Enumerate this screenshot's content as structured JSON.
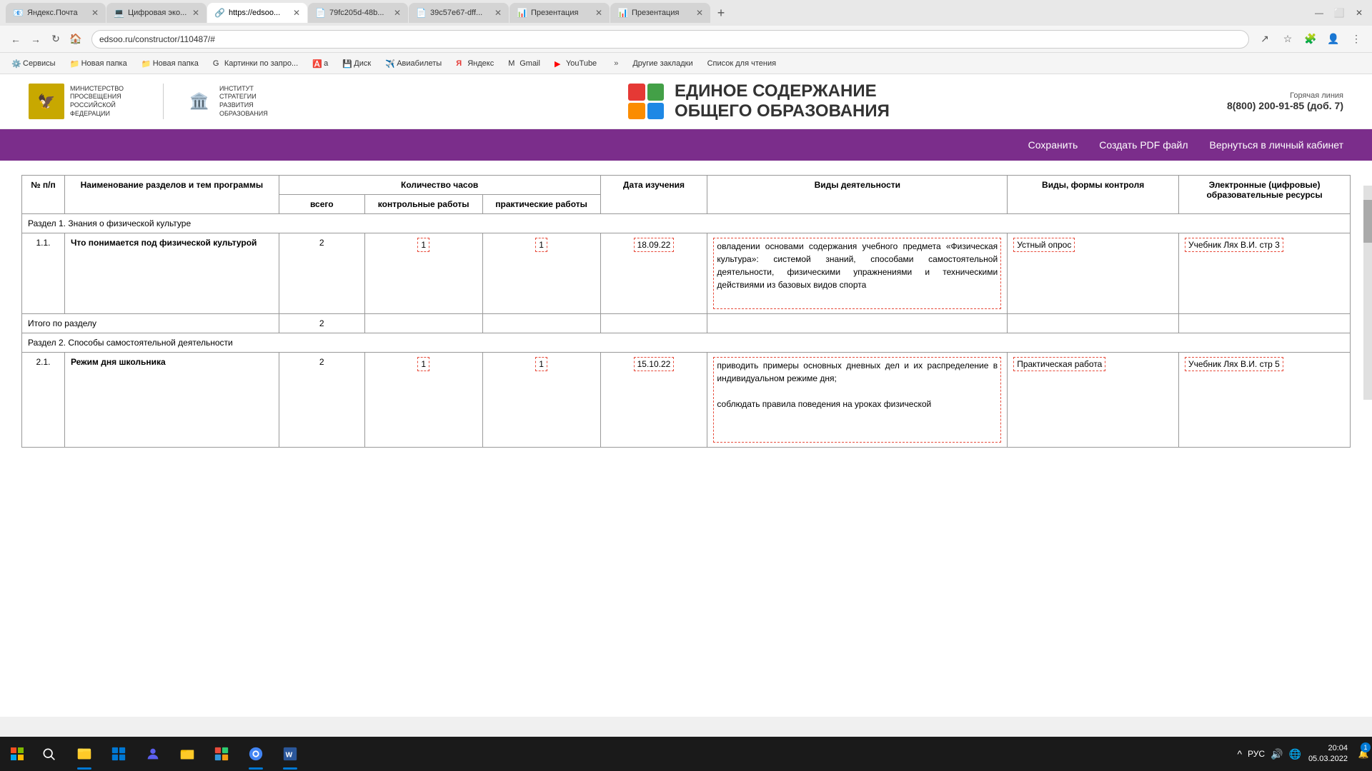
{
  "browser": {
    "tabs": [
      {
        "id": "tab1",
        "label": "Яндекс.Почта",
        "favicon": "📧",
        "active": false
      },
      {
        "id": "tab2",
        "label": "Цифровая эко...",
        "favicon": "💻",
        "active": false
      },
      {
        "id": "tab3",
        "label": "https://edsoo...",
        "favicon": "🔗",
        "active": true
      },
      {
        "id": "tab4",
        "label": "79fc205d-48b...",
        "favicon": "📄",
        "active": false
      },
      {
        "id": "tab5",
        "label": "39c57e67-dff...",
        "favicon": "📄",
        "active": false
      },
      {
        "id": "tab6",
        "label": "Презентация",
        "favicon": "📊",
        "active": false
      },
      {
        "id": "tab7",
        "label": "Презентация",
        "favicon": "📊",
        "active": false
      }
    ],
    "address": "edsoo.ru/constructor/110487/#",
    "bookmarks": [
      {
        "label": "Сервисы",
        "favicon": "⚙️"
      },
      {
        "label": "Новая папка",
        "favicon": "📁"
      },
      {
        "label": "Новая папка",
        "favicon": "📁"
      },
      {
        "label": "Картинки по запро...",
        "favicon": "G"
      },
      {
        "label": "a",
        "favicon": "🅰️"
      },
      {
        "label": "Диск",
        "favicon": "💾"
      },
      {
        "label": "Авиабилеты",
        "favicon": "✈️"
      },
      {
        "label": "Яндекс",
        "favicon": "Я"
      },
      {
        "label": "Gmail",
        "favicon": "M"
      },
      {
        "label": "YouTube",
        "favicon": "▶️"
      }
    ],
    "bookmarks_more": "»",
    "other_bookmarks": "Другие закладки",
    "reading_list": "Список для чтения"
  },
  "site": {
    "ministry_text": "МИНИСТЕРСТВО ПРОСВЕЩЕНИЯ РОССИЙСКОЙ ФЕДЕРАЦИИ",
    "institute_text": "ИНСТИТУТ СТРАТЕГИИ РАЗВИТИЯ ОБРАЗОВАНИЯ",
    "title_line1": "ЕДИНОЕ СОДЕРЖАНИЕ",
    "title_line2": "ОБЩЕГО ОБРАЗОВАНИЯ",
    "hotline_label": "Горячая линия",
    "hotline_number": "8(800) 200-91-85 (доб. 7)"
  },
  "nav": {
    "save": "Сохранить",
    "create_pdf": "Создать PDF файл",
    "back_to_cabinet": "Вернуться в личный кабинет"
  },
  "table": {
    "headers": {
      "num": "№ п/п",
      "name": "Наименование разделов и тем программы",
      "hours_group": "Количество часов",
      "hours_total": "всего",
      "hours_control": "контрольные работы",
      "hours_practical": "практические работы",
      "date": "Дата изучения",
      "activity": "Виды деятельности",
      "forms": "Виды, формы контроля",
      "resources": "Электронные (цифровые) образовательные ресурсы"
    },
    "section1": {
      "label": "Раздел 1. Знания о физической культуре",
      "rows": [
        {
          "num": "1.1.",
          "name": "Что понимается под физической культурой",
          "total": "2",
          "control": "1",
          "practical": "1",
          "date": "18.09.22",
          "activity": "овладении основами содержания учебного предмета «Физическая культура»: системой знаний, способами самостоятельной деятельности, физическими упражнениями и техническими действиями из базовых видов спорта",
          "forms": "Устный опрос",
          "resources": "Учебник Лях В.И. стр 3"
        }
      ],
      "total_row": {
        "label": "Итого по разделу",
        "total": "2"
      }
    },
    "section2": {
      "label": "Раздел 2. Способы самостоятельной деятельности",
      "rows": [
        {
          "num": "2.1.",
          "name": "Режим дня школьника",
          "total": "2",
          "control": "1",
          "practical": "1",
          "date": "15.10.22",
          "activity": "приводить примеры основных дневных дел и их распределение в индивидуальном режиме дня;\n\nсоблюдать правила поведения на уроках физической",
          "forms": "Практическая работа",
          "resources": "Учебник Лях В.И. стр 5"
        }
      ]
    }
  },
  "taskbar": {
    "time": "20:04",
    "date": "05.03.2022",
    "notification_count": "1",
    "lang": "РУС"
  }
}
